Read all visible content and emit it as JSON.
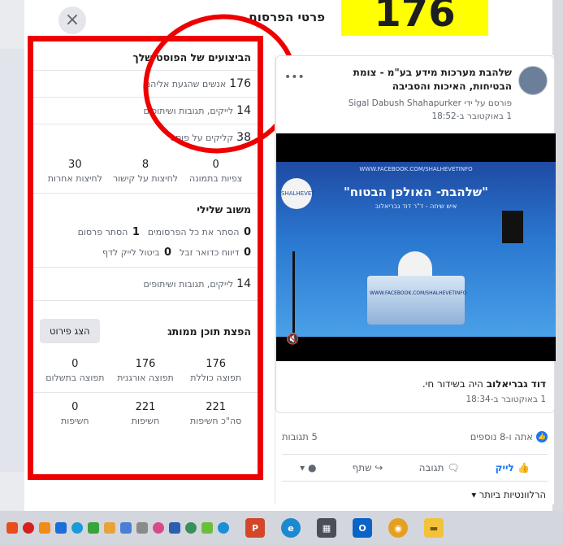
{
  "modal": {
    "title": "פרטי הפרסום",
    "close_label": "×",
    "badge_number": "176"
  },
  "performance": {
    "heading": "הביצועים של הפוסט שלך",
    "people_reached_num": "176",
    "people_reached_label": "אנשים שהגעת אליהם",
    "engagement_num": "14",
    "engagement_label": "לייקים, תגובות ושיתופים",
    "post_clicks_num": "38",
    "post_clicks_label": "קליקים על פוסט",
    "clicks": [
      {
        "num": "0",
        "label": "צפיות בתמונה"
      },
      {
        "num": "8",
        "label": "לחיצות על קישור"
      },
      {
        "num": "30",
        "label": "לחיצות אחרות"
      }
    ]
  },
  "negative": {
    "heading": "משוב שלילי",
    "hide_all_num": "1",
    "hide_all_label": "הסתר את כל הפרסומים",
    "hide_post_num": "0",
    "hide_post_label": "הסתר פרסום",
    "report_spam_num": "0",
    "report_spam_label": "דיווח כדואר זבל",
    "unlike_num": "0",
    "unlike_label": "ביטול לייק לדף"
  },
  "engagement_total": {
    "num": "14",
    "label": "לייקים, תגובות ושיתופים"
  },
  "distribution": {
    "heading": "הפצת תוכן ממותג",
    "button_label": "הצג פירוט",
    "reach": [
      {
        "num": "176",
        "label": "תפוצה כוללת"
      },
      {
        "num": "176",
        "label": "תפוצה אורגנית"
      },
      {
        "num": "0",
        "label": "תפוצה בתשלום"
      }
    ],
    "impressions": [
      {
        "num": "221",
        "label": "סה\"כ חשיפות"
      },
      {
        "num": "221",
        "label": "חשיפות"
      },
      {
        "num": "0",
        "label": "חשיפות"
      }
    ]
  },
  "post": {
    "page_name": "שלהבת מערכות מידע בע\"מ - צומת הבטיחות, האיכות והסביבה",
    "posted_by": "פורסם על ידי Sigal Dabush Shahapurker",
    "date": "1 באוקטובר ב-18:52",
    "more_label": "•••",
    "video_url_text": "WWW.FACEBOOK.COM/SHALHEVETINFO",
    "video_banner": "\"שלהבת- האולפן הבטוח\"",
    "video_sub": "איש שיחה - ד\"ר דוד גבריאלוב",
    "desk_url": "WWW.FACEBOOK.COM/SHALHEVETINFO",
    "logo_text": "SHALHEVET",
    "mute_icon": "🔇",
    "shared_name": "דוד גבריאלוב",
    "shared_text": "היה בשידור חי.",
    "shared_date": "1 באוקטובר ב-18:34",
    "likes_text": "אתה ו-8 נוספים",
    "comments_text": "5 תגובות",
    "action_like": "לייק",
    "action_comment": "תגובה",
    "action_share": "שתף",
    "relevance_label": "הרלוונטיות ביותר"
  },
  "colors": {
    "highlight_red": "#ee0000",
    "badge_yellow": "#ffff00",
    "facebook_blue": "#1877f2"
  }
}
